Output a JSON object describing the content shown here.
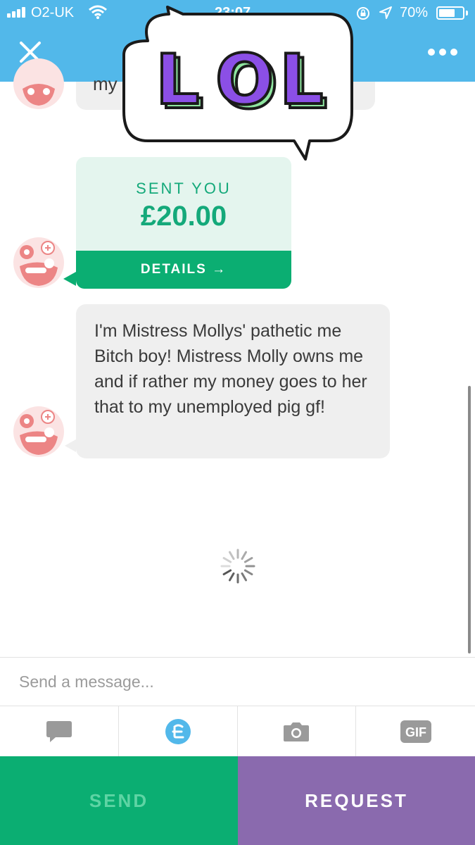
{
  "status_bar": {
    "carrier": "O2-UK",
    "time": "23:07",
    "battery_percent": "70%",
    "battery_level": 0.7,
    "icons": [
      "signal-icon",
      "wifi-icon",
      "rotation-lock-icon",
      "location-icon",
      "battery-icon"
    ]
  },
  "header": {
    "close_icon": "close-icon",
    "more_icon": "more-icon",
    "color": "#52b8ea"
  },
  "sticker": {
    "text": "LOL"
  },
  "messages": {
    "top_partial": "my",
    "payment": {
      "label": "SENT YOU",
      "amount": "£20.00",
      "details": "DETAILS →"
    },
    "text": "I'm Mistress Mollys' pathetic me Bitch boy! Mistress Molly owns me and if rather my money goes to her that to my unemployed pig gf!"
  },
  "composer": {
    "placeholder": "Send a message...",
    "tools": [
      "message-icon",
      "cash-icon",
      "camera-icon",
      "gif-icon"
    ],
    "gif_label": "GIF"
  },
  "actions": {
    "send_label": "SEND",
    "request_label": "REQUEST"
  },
  "colors": {
    "green": "#0bae72",
    "purple": "#8a6aae",
    "avatar": "#ec8585"
  }
}
